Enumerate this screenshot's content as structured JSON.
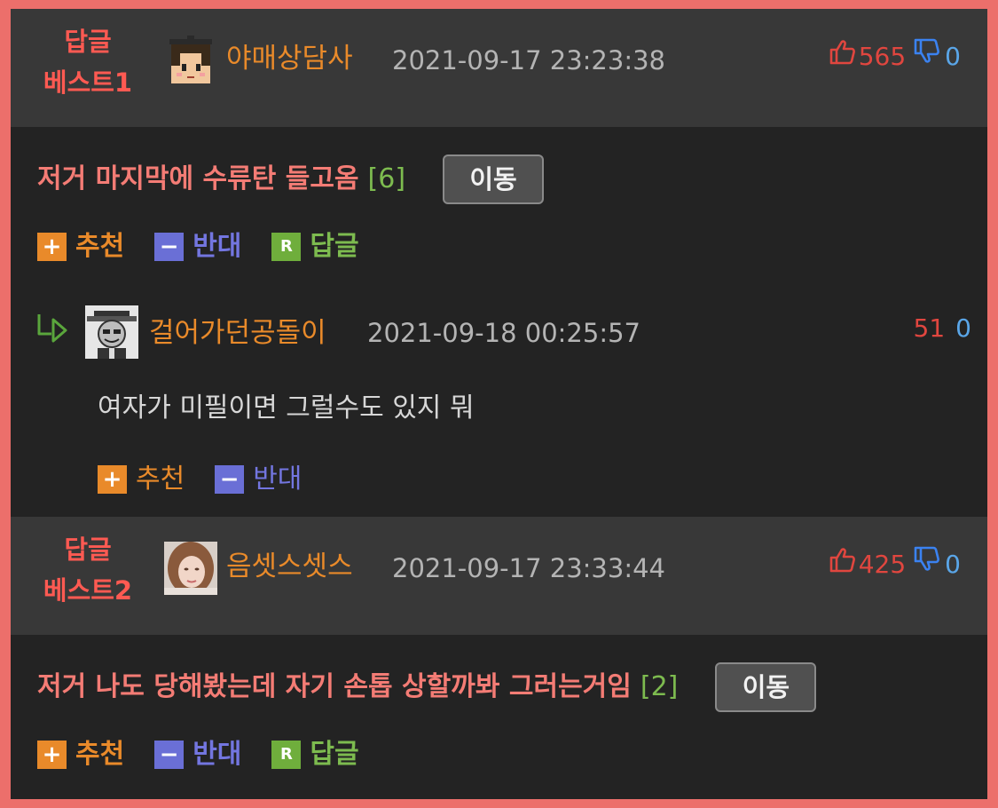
{
  "best1": {
    "tag_line1": "답글",
    "tag_line2": "베스트1",
    "nickname": "야매상담사",
    "datetime": "2021-09-17 23:23:38",
    "upvotes": "565",
    "downvotes": "0",
    "content": "저거 마지막에 수류탄 들고옴",
    "reply_count": "[6]",
    "move_label": "이동",
    "actions": {
      "recommend": "추천",
      "oppose": "반대",
      "reply": "답글"
    },
    "reply": {
      "nickname": "걸어가던공돌이",
      "datetime": "2021-09-18 00:25:57",
      "upvotes": "51",
      "downvotes": "0",
      "content": "여자가 미필이면 그럴수도 있지 뭐",
      "actions": {
        "recommend": "추천",
        "oppose": "반대"
      }
    }
  },
  "best2": {
    "tag_line1": "답글",
    "tag_line2": "베스트2",
    "nickname": "음셋스셋스",
    "datetime": "2021-09-17 23:33:44",
    "upvotes": "425",
    "downvotes": "0",
    "content": "저거 나도 당해봤는데 자기 손톱 상할까봐 그러는거임",
    "reply_count": "[2]",
    "move_label": "이동",
    "actions": {
      "recommend": "추천",
      "oppose": "반대",
      "reply": "답글"
    }
  },
  "icons": {
    "plus_glyph": "+",
    "minus_glyph": "−",
    "r_glyph": "R"
  },
  "colors": {
    "frame_border": "#ec6f6b",
    "best_tag": "#ff5a52",
    "nickname": "#e98a2a",
    "upvote": "#e0463f",
    "downvote": "#5aa6e8"
  }
}
